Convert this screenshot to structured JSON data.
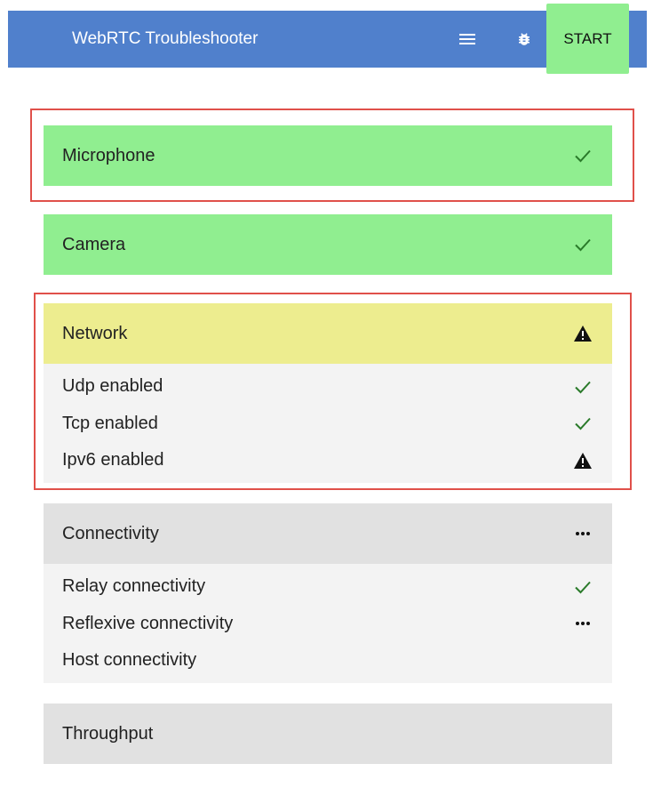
{
  "header": {
    "title": "WebRTC Troubleshooter",
    "menu_icon": "menu-icon",
    "bug_icon": "bug-icon",
    "start_label": "START"
  },
  "colors": {
    "toolbar": "#5080cc",
    "ok": "#90ee90",
    "warning": "#eded8f",
    "pending": "#e1e1e1",
    "highlight": "#e0504a"
  },
  "tests": [
    {
      "label": "Microphone",
      "status": "ok",
      "status_icon": "check-icon",
      "highlighted": true,
      "subtests": []
    },
    {
      "label": "Camera",
      "status": "ok",
      "status_icon": "check-icon",
      "highlighted": false,
      "subtests": []
    },
    {
      "label": "Network",
      "status": "warning",
      "status_icon": "warning-icon",
      "highlighted": true,
      "subtests": [
        {
          "label": "Udp enabled",
          "status_icon": "check-icon"
        },
        {
          "label": "Tcp enabled",
          "status_icon": "check-icon"
        },
        {
          "label": "Ipv6 enabled",
          "status_icon": "warning-icon"
        }
      ]
    },
    {
      "label": "Connectivity",
      "status": "running",
      "status_icon": "more-icon",
      "highlighted": false,
      "subtests": [
        {
          "label": "Relay connectivity",
          "status_icon": "check-icon"
        },
        {
          "label": "Reflexive connectivity",
          "status_icon": "more-icon"
        },
        {
          "label": "Host connectivity",
          "status_icon": ""
        }
      ]
    },
    {
      "label": "Throughput",
      "status": "pending",
      "status_icon": "",
      "highlighted": false,
      "subtests": []
    }
  ]
}
